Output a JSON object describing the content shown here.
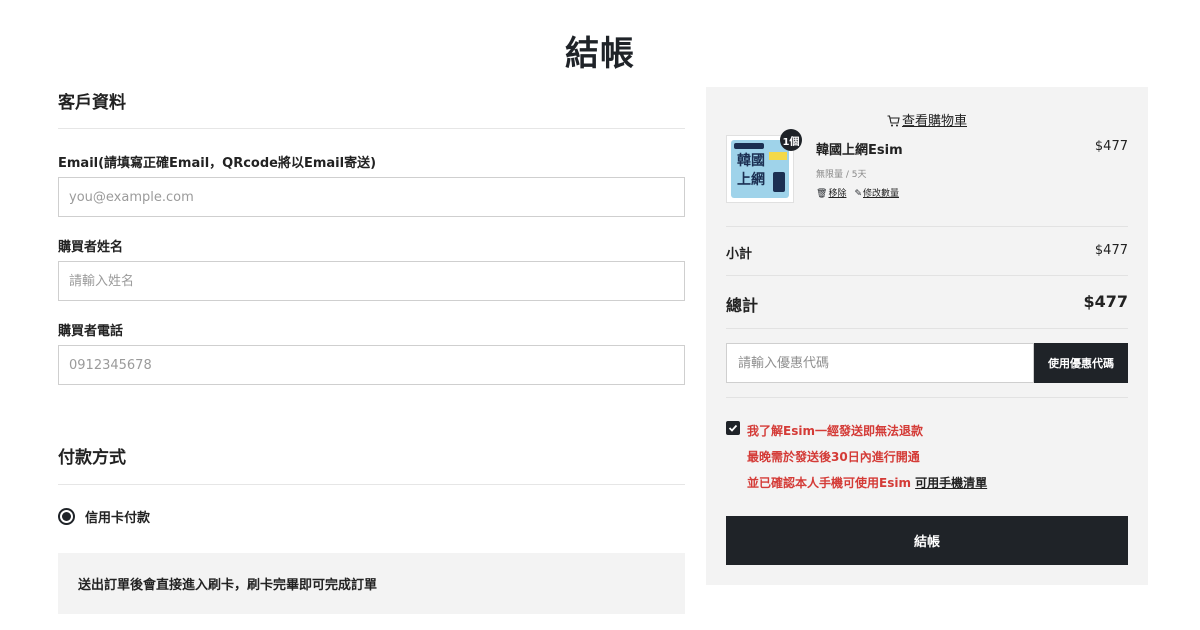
{
  "page": {
    "title": "結帳"
  },
  "customer": {
    "section_title": "客戶資料",
    "email_label": "Email(請填寫正確Email，QRcode將以Email寄送)",
    "email_placeholder": "you@example.com",
    "name_label": "購買者姓名",
    "name_placeholder": "請輸入姓名",
    "phone_label": "購買者電話",
    "phone_placeholder": "0912345678"
  },
  "payment": {
    "section_title": "付款方式",
    "option_label": "信用卡付款",
    "info": "送出訂單後會直接進入刷卡，刷卡完畢即可完成訂單"
  },
  "cart": {
    "view_cart": "查看購物車",
    "item": {
      "qty_badge": "1個",
      "name": "韓國上網Esim",
      "price": "$477",
      "variant": "無限量 / 5天",
      "remove": "移除",
      "edit_qty": "修改數量",
      "thumb_text": "韓國上網"
    },
    "subtotal_label": "小計",
    "subtotal_value": "$477",
    "total_label": "總計",
    "total_value": "$477",
    "coupon_placeholder": "請輸入優惠代碼",
    "coupon_button": "使用優惠代碼",
    "terms_line1": "我了解Esim一經發送即無法退款",
    "terms_line2": "最晚需於發送後30日內進行開通",
    "terms_line3": "並已確認本人手機可使用Esim ",
    "terms_link": "可用手機清單",
    "checkout_button": "結帳"
  },
  "colors": {
    "accent": "#1f2328",
    "warning": "#d43b37",
    "panel": "#f3f3f3"
  }
}
